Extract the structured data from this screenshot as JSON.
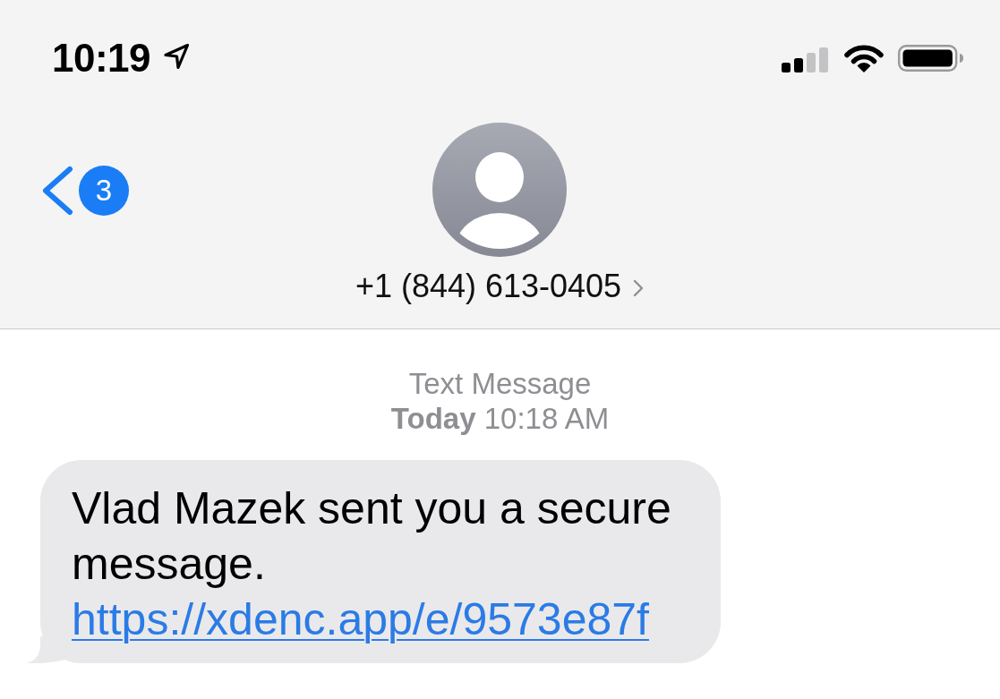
{
  "status_bar": {
    "time": "10:19"
  },
  "nav_bar": {
    "back_badge": "3",
    "contact": "+1 (844) 613-0405"
  },
  "conversation": {
    "service_label": "Text Message",
    "timestamp": "**Today** 10:18 AM",
    "messages": [
      {
        "kind": "incoming",
        "text": "Vlad Mazek sent you a secure message.",
        "link": "https://xdenc.app/e/9573e87f"
      }
    ]
  }
}
